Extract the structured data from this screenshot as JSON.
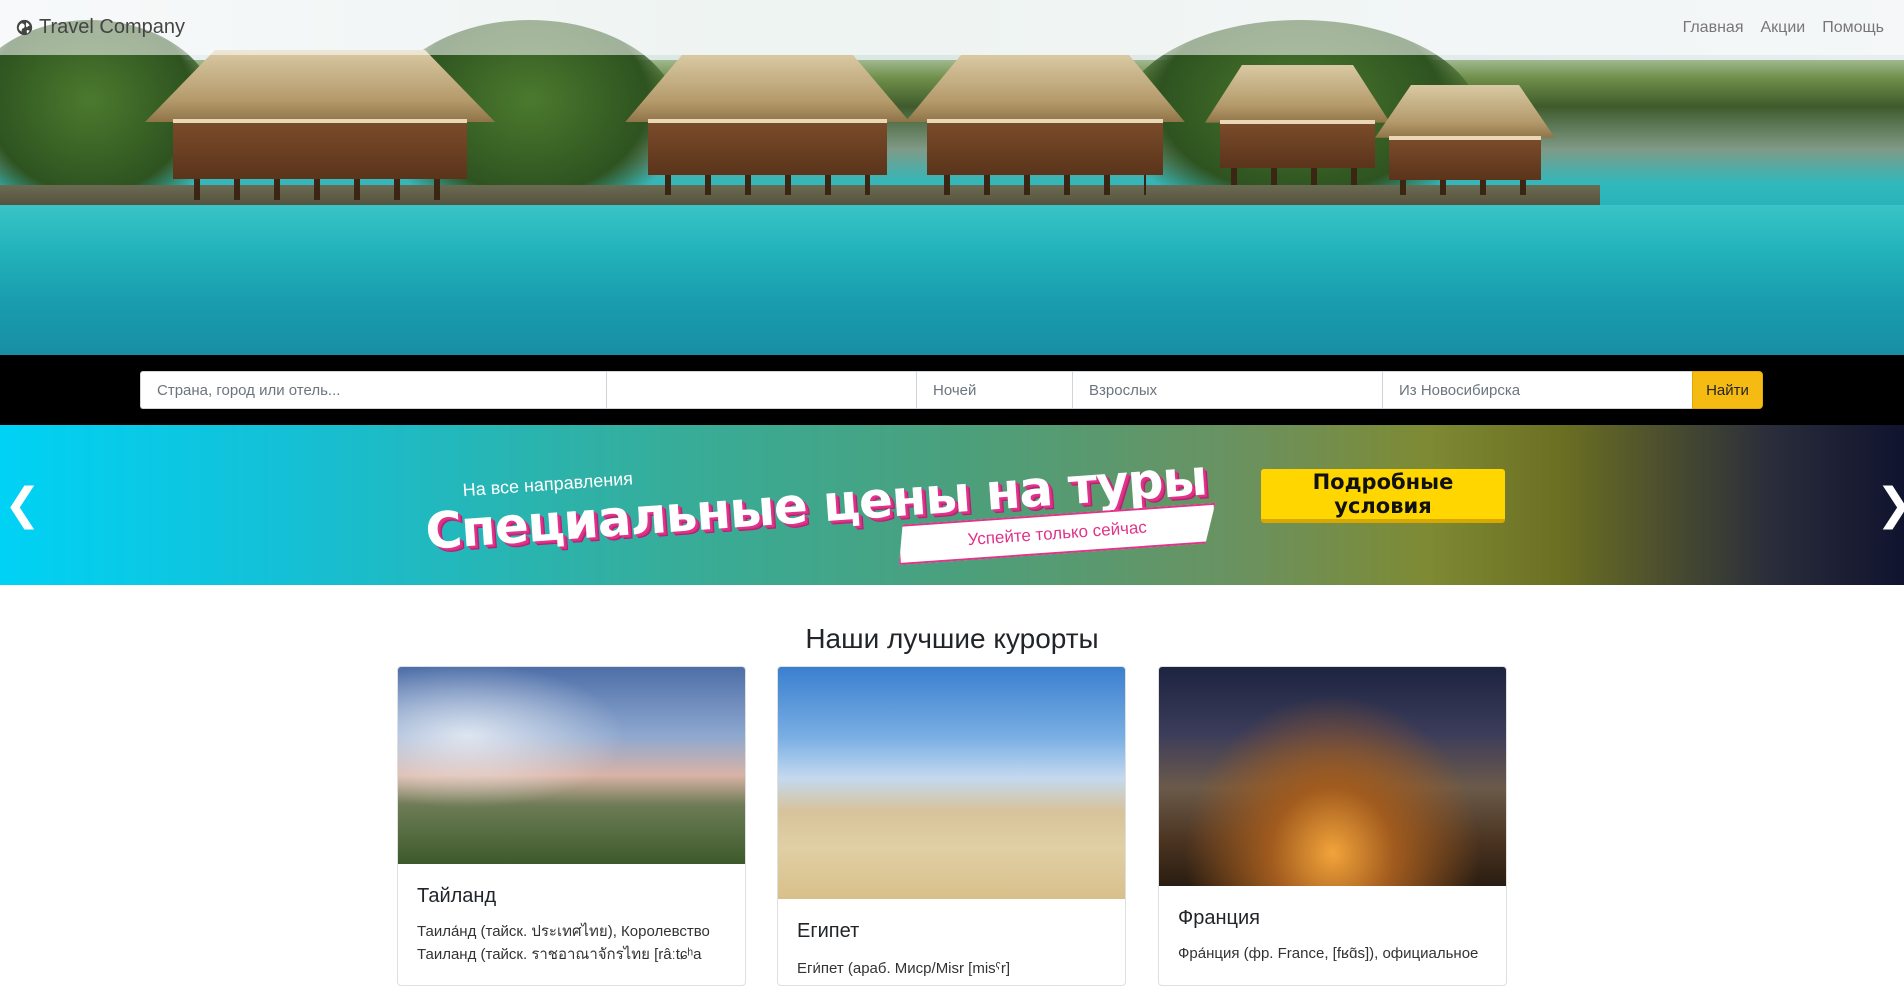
{
  "navbar": {
    "brand": "Travel Company",
    "links": [
      "Главная",
      "Акции",
      "Помощь"
    ]
  },
  "search": {
    "place_placeholder": "Страна, город или отель...",
    "date_placeholder": "",
    "nights_placeholder": "Ночей",
    "adults_placeholder": "Взрослых",
    "from_placeholder": "Из Новосибирска",
    "submit_label": "Найти"
  },
  "promo": {
    "subtitle": "На все направления",
    "title": "Специальные цены на туры",
    "ribbon": "Успейте только сейчас",
    "button_label": "Подробные условия",
    "prev_glyph": "❮",
    "next_glyph": "❯"
  },
  "resorts": {
    "heading": "Наши лучшие курорты",
    "cards": [
      {
        "title": "Тайланд",
        "text": "Таила́нд (тайск. ประเทศไทย), Королевство Таиланд (тайск. ราชอาณาจักรไทย [râːtɕʰa"
      },
      {
        "title": "Египет",
        "text": "Еги́пет (араб. Миср/Misr [misˤr]"
      },
      {
        "title": "Франция",
        "text": "Фра́нция (фр. France, [fʁɑ̃s]), официальное"
      }
    ]
  },
  "colors": {
    "accent_yellow": "#f5bb12",
    "promo_button": "#ffd600",
    "promo_pink": "#e0338a"
  }
}
